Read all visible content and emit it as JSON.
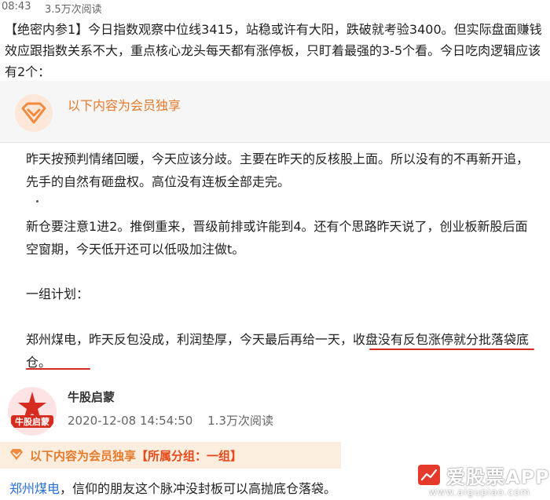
{
  "header": {
    "time": "08:43",
    "reads": "3.5万次阅读"
  },
  "intro": {
    "text": "【绝密内参1】今日指数观察中位线3415，站稳或许有大阳，跌破就考验3400。但实际盘面赚钱效应跟指数关系不大，重点核心龙头每天都有涨停板，只盯着最强的3-5个看。今日吃肉逻辑应该有2个："
  },
  "member_card": {
    "title": "以下内容为会员独享",
    "icon": "diamond-icon",
    "accent_color": "#e57a2c",
    "paragraphs": [
      "昨天按预判情绪回暖，今天应该分歧。主要在昨天的反核股上面。所以没有的不再新开追，先手的自然有砸盘权。高位没有连板全部走完。",
      "新仓要注意1进2。推倒重来，晋级前排或许能到4。还有个思路昨天说了，创业板新股后面空窗期，今天低开还可以低吸加注做t。",
      "一组计划：",
      "郑州煤电，昨天反包没成，利润垫厚，今天最后再给一天，收盘没有反包涨停就分批落袋底仓。"
    ]
  },
  "post2": {
    "author": "牛股启蒙",
    "avatar_text": "牛股启蒙",
    "datetime": "2020-12-08 14:54:50",
    "reads": "1.3万次阅读",
    "member_label": "以下内容为会员独享",
    "group_label": "【所属分组：一组】",
    "stock_link": "郑州煤电",
    "text_rest": "，信仰的朋友这个脉冲没封板可以高抛底仓落袋。"
  },
  "watermark": {
    "name": "爱股票APP",
    "url": "www.aigupiao.com",
    "logo_text": "爱股票"
  }
}
